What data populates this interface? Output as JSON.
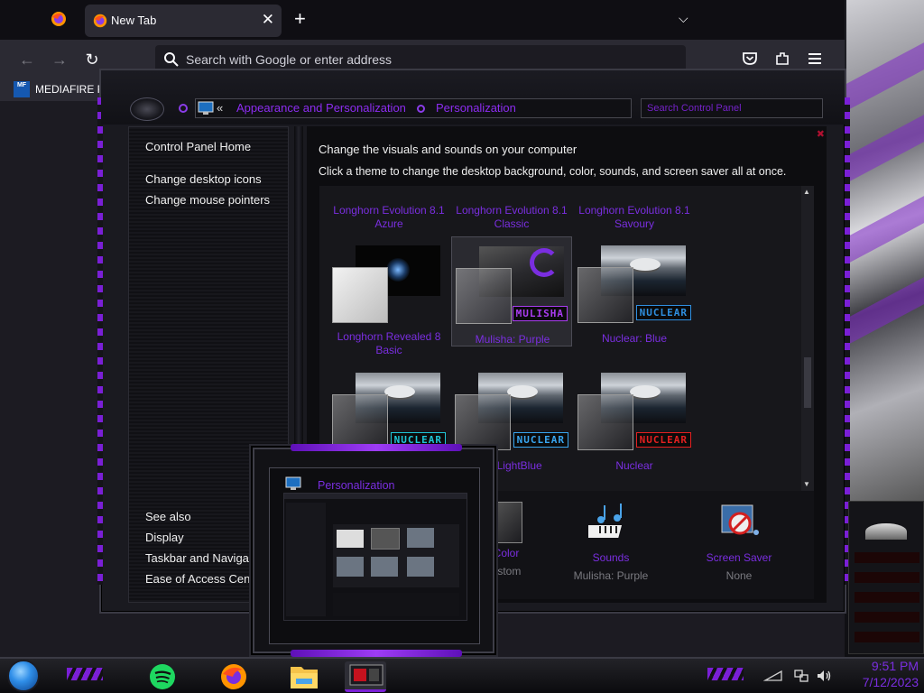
{
  "browser": {
    "tab_title": "New Tab",
    "url_placeholder": "Search with Google or enter address",
    "bookmark_label": "MEDIAFIRE R",
    "bookmark_logo": "MF"
  },
  "control_panel": {
    "breadcrumb": [
      "Appearance and Personalization",
      "Personalization"
    ],
    "chevrons": "«",
    "search_placeholder": "Search Control Panel",
    "sidebar_top": [
      "Control Panel Home",
      "Change desktop icons",
      "Change mouse pointers"
    ],
    "sidebar_bottom": [
      "See also",
      "Display",
      "Taskbar and Navigation",
      "Ease of Access Center"
    ],
    "heading": "Change the visuals and sounds on your computer",
    "subheading": "Click a theme to change the desktop background, color, sounds, and screen saver all at once.",
    "themes_row1": [
      {
        "name": "Longhorn Evolution 8.1 Azure"
      },
      {
        "name": "Longhorn Evolution 8.1 Classic"
      },
      {
        "name": "Longhorn Evolution 8.1 Savoury"
      }
    ],
    "themes_row2": [
      {
        "name": "Longhorn Revealed 8 Basic",
        "badge": ""
      },
      {
        "name": "Mulisha: Purple",
        "badge": "MULISHA",
        "badge_color": "#a93cf0"
      },
      {
        "name": "Nuclear: Blue",
        "badge": "NUCLEAR",
        "badge_color": "#2f8fe0"
      }
    ],
    "themes_row3": [
      {
        "name": "",
        "badge": "NUCLEAR",
        "badge_color": "#1fc7d8"
      },
      {
        "name": "ar: LightBlue",
        "badge": "NUCLEAR",
        "badge_color": "#39a6f0"
      },
      {
        "name": "Nuclear",
        "badge": "NUCLEAR",
        "badge_color": "#e42020"
      }
    ],
    "bottom": [
      {
        "label": "Color",
        "value": "ustom",
        "icon": "color-swatch-icon"
      },
      {
        "label": "Sounds",
        "value": "Mulisha: Purple",
        "icon": "music-notes-icon"
      },
      {
        "label": "Screen Saver",
        "value": "None",
        "icon": "screen-saver-icon"
      }
    ]
  },
  "preview": {
    "title": "Personalization"
  },
  "taskbar": {
    "apps": [
      "start-orb",
      "spotify",
      "firefox",
      "file-explorer",
      "control-panel"
    ],
    "time": "9:51 PM",
    "date": "7/12/2023",
    "tray_icons": [
      "network-icon",
      "volume-icon"
    ]
  },
  "colors": {
    "accent_purple": "#7a2ee0",
    "frame_purple": "#7a1fd6",
    "firefox_dark": "#1c1b22"
  }
}
